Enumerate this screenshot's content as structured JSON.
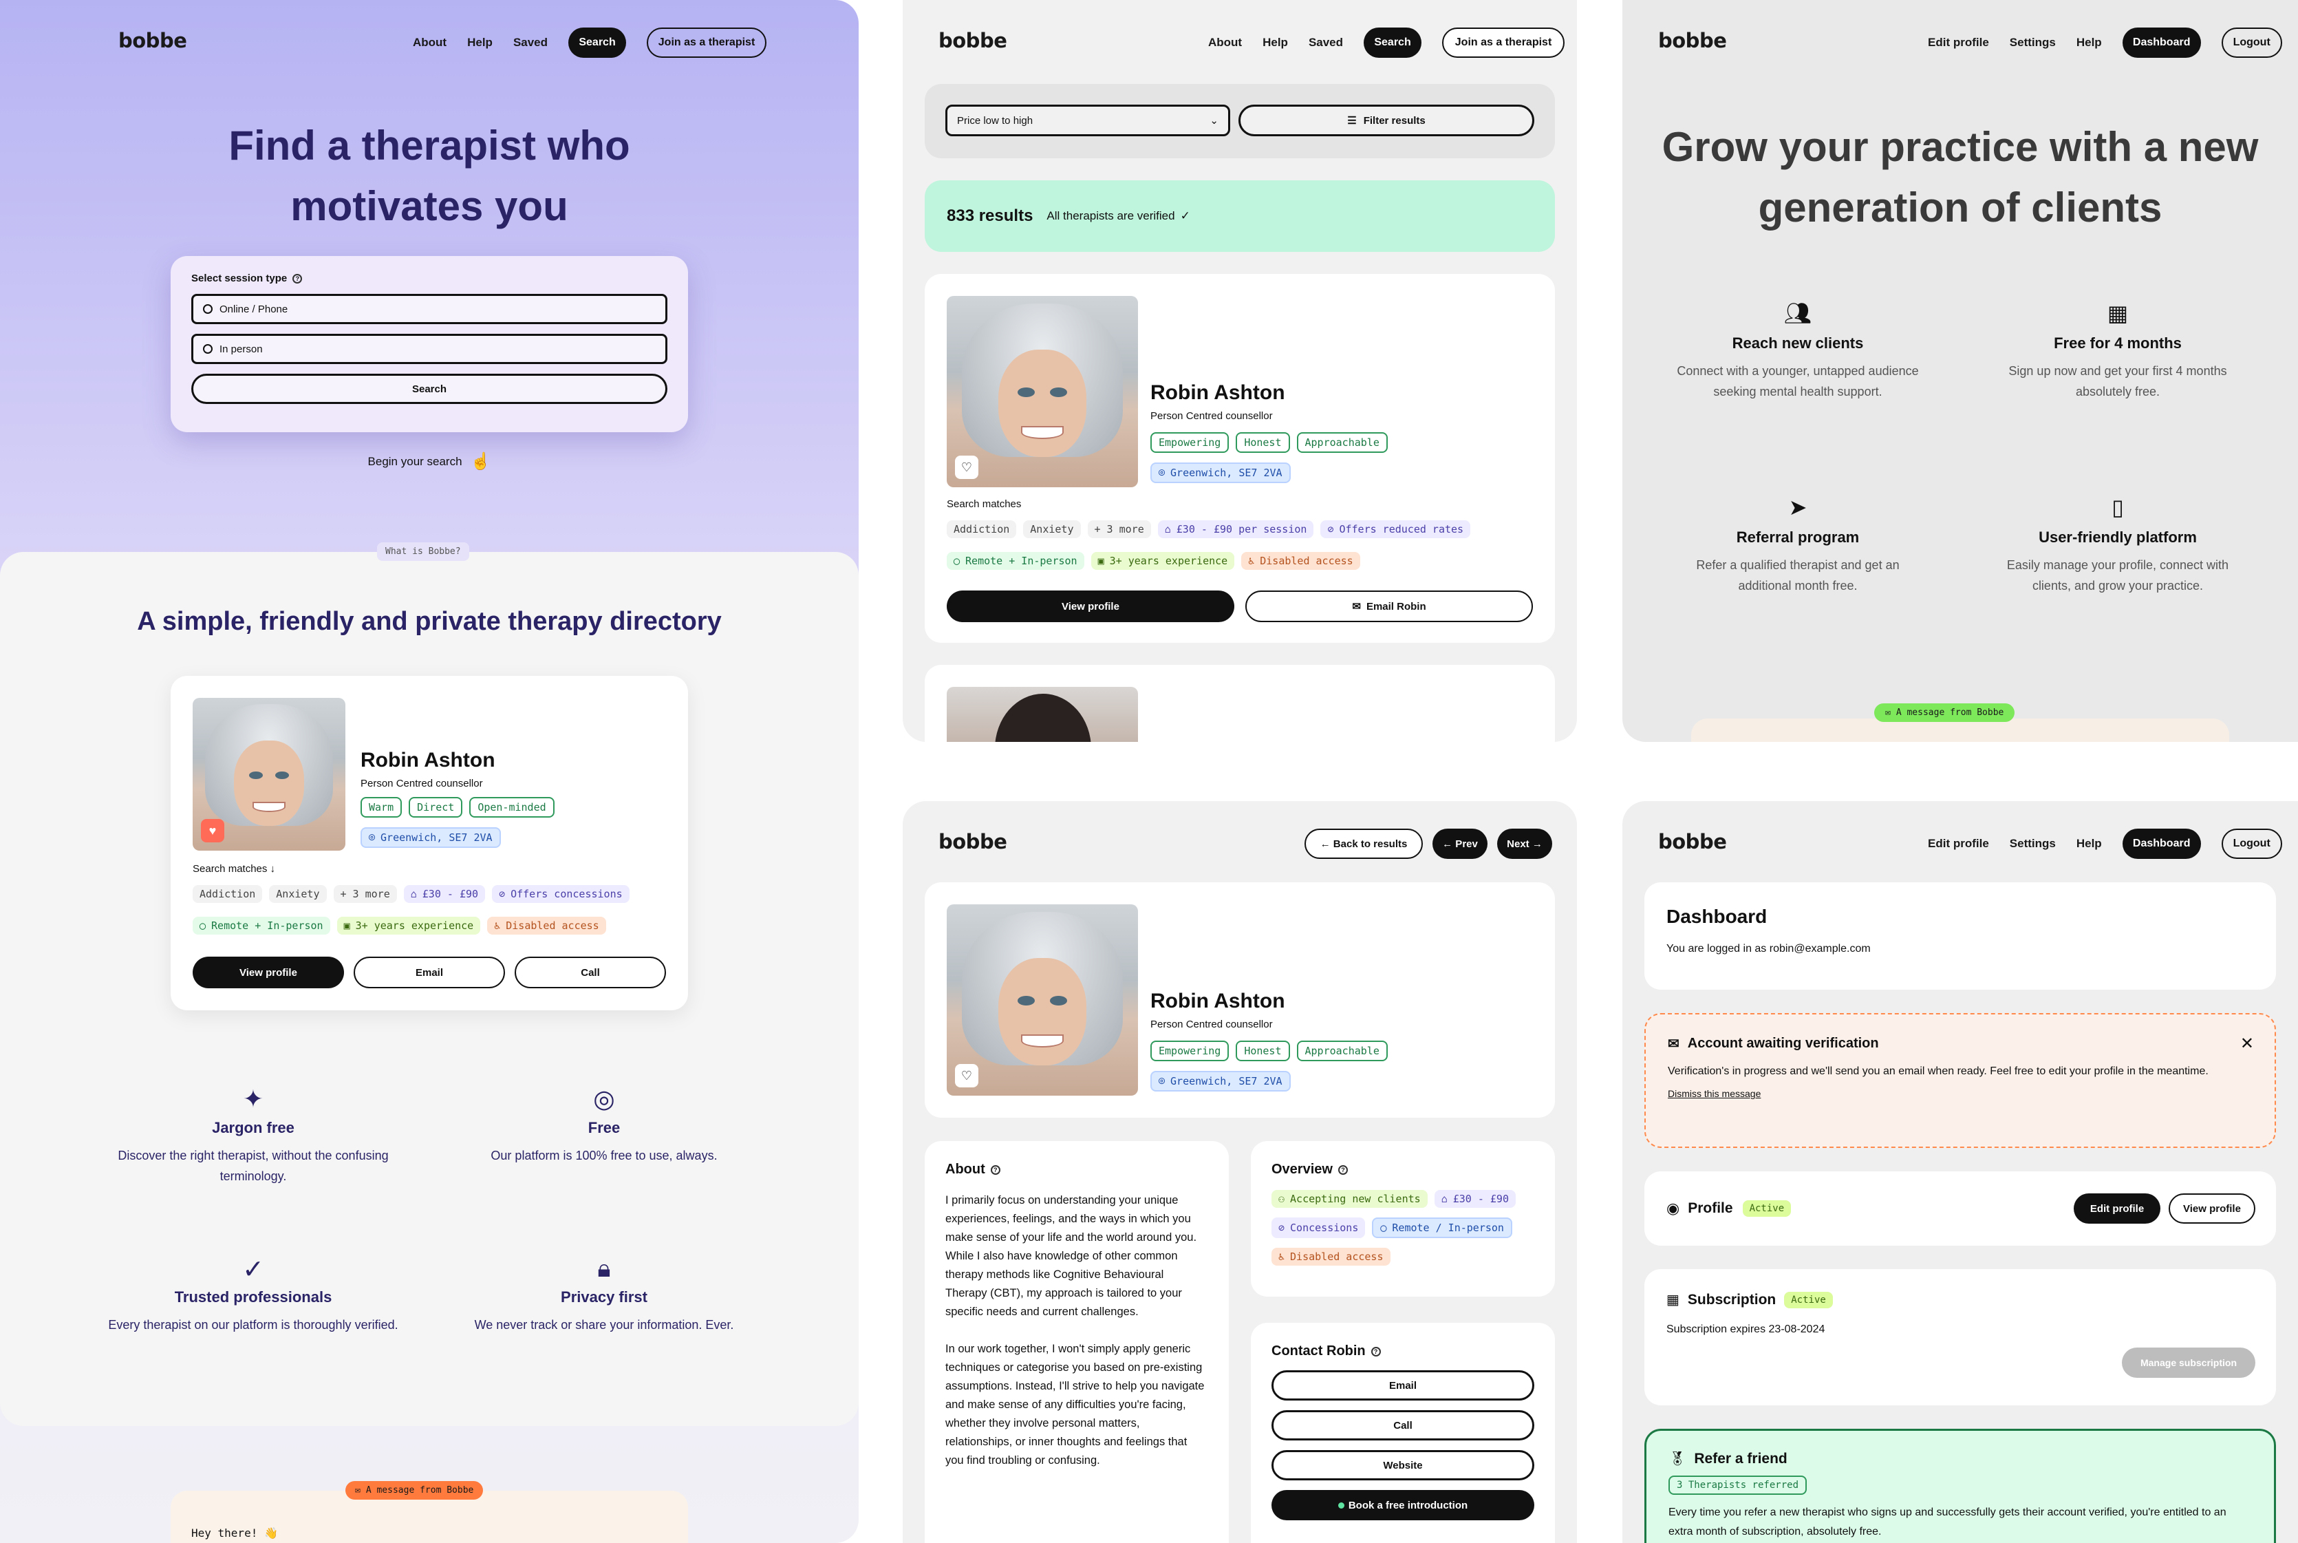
{
  "p1": {
    "logo": "bobbe",
    "nav": [
      "About",
      "Help",
      "Saved"
    ],
    "search_btn": "Search",
    "join_btn": "Join as a therapist",
    "hero_line1": "Find a therapist who",
    "hero_line2": "motivates you",
    "session_label": "Select session type",
    "opt1": "Online / Phone",
    "opt2": "In person",
    "search_button": "Search",
    "begin": "Begin your search",
    "what_tag": "What is Bobbe?",
    "subtitle": "A simple, friendly and private therapy directory",
    "card": {
      "name": "Robin Ashton",
      "role": "Person Centred counsellor",
      "tags": [
        "Warm",
        "Direct",
        "Open-minded"
      ],
      "location": "Greenwich, SE7 2VA",
      "matches": "Search matches ↓",
      "m1": "Addiction",
      "m2": "Anxiety",
      "m3": "+ 3 more",
      "m4": "£30 - £90",
      "m5": "Offers concessions",
      "m6": "Remote + In-person",
      "m7": "3+ years experience",
      "m8": "Disabled access",
      "view": "View profile",
      "email": "Email",
      "call": "Call"
    },
    "features": [
      {
        "title": "Jargon free",
        "text": "Discover the right therapist, without the confusing terminology.",
        "icon": "party-popper-icon"
      },
      {
        "title": "Free",
        "text": "Our platform is 100% free to use, always.",
        "icon": "coins-icon"
      },
      {
        "title": "Trusted professionals",
        "text": "Every therapist on our platform is thoroughly verified.",
        "icon": "check-circle-icon"
      },
      {
        "title": "Privacy first",
        "text": "We never track or share your information. Ever.",
        "icon": "lock-icon"
      }
    ],
    "msg_tag": "A message from Bobbe",
    "msg_text": "Hey there! 👋"
  },
  "p2": {
    "logo": "bobbe",
    "nav": [
      "About",
      "Help",
      "Saved"
    ],
    "search_btn": "Search",
    "join_btn": "Join as a therapist",
    "sort": "Price low to high",
    "filter": "Filter results",
    "count": "833 results",
    "verified": "All therapists are verified",
    "card": {
      "name": "Robin Ashton",
      "role": "Person Centred counsellor",
      "tags": [
        "Empowering",
        "Honest",
        "Approachable"
      ],
      "location": "Greenwich, SE7 2VA",
      "matches": "Search matches",
      "m1": "Addiction",
      "m2": "Anxiety",
      "m3": "+ 3 more",
      "m4": "£30 - £90 per session",
      "m5": "Offers reduced rates",
      "m6": "Remote + In-person",
      "m7": "3+ years experience",
      "m8": "Disabled access",
      "view": "View profile",
      "email": "Email Robin"
    }
  },
  "p3": {
    "logo": "bobbe",
    "nav": [
      "Edit profile",
      "Settings",
      "Help"
    ],
    "dash": "Dashboard",
    "logout": "Logout",
    "hero_line1": "Grow your practice with a new",
    "hero_line2": "generation of clients",
    "features": [
      {
        "title": "Reach new clients",
        "text": "Connect with a younger, untapped audience seeking mental health support.",
        "icon": "users-icon"
      },
      {
        "title": "Free for 4 months",
        "text": "Sign up now and get your first 4 months absolutely free.",
        "icon": "calendar-icon"
      },
      {
        "title": "Referral program",
        "text": "Refer a qualified therapist and get an additional month free.",
        "icon": "send-icon"
      },
      {
        "title": "User-friendly platform",
        "text": "Easily manage your profile, connect with clients, and grow your practice.",
        "icon": "tablet-icon"
      }
    ],
    "msg_tag": "A message from Bobbe"
  },
  "p4": {
    "logo": "bobbe",
    "back": "← Back to results",
    "prev": "← Prev",
    "next": "Next →",
    "card": {
      "name": "Robin Ashton",
      "role": "Person Centred counsellor",
      "tags": [
        "Empowering",
        "Honest",
        "Approachable"
      ],
      "location": "Greenwich, SE7 2VA"
    },
    "about_title": "About",
    "about_p1": "I primarily focus on understanding your unique experiences, feelings, and the ways in which you make sense of your life and the world around you. While I also have knowledge of other common therapy methods like Cognitive Behavioural Therapy (CBT), my approach is tailored to your specific needs and current challenges.",
    "about_p2": "In our work together, I won't simply apply generic techniques or categorise you based on pre-existing assumptions. Instead, I'll strive to help you navigate and make sense of any difficulties you're facing, whether they involve personal matters, relationships, or inner thoughts and feelings that you find troubling or confusing.",
    "overview_title": "Overview",
    "ov1": "Accepting new clients",
    "ov2": "£30 - £90",
    "ov3": "Concessions",
    "ov4": "Remote / In-person",
    "ov5": "Disabled access",
    "contact_title": "Contact Robin",
    "c_email": "Email",
    "c_call": "Call",
    "c_web": "Website",
    "c_book": "Book a free introduction"
  },
  "p5": {
    "logo": "bobbe",
    "nav": [
      "Edit profile",
      "Settings",
      "Help"
    ],
    "dash": "Dashboard",
    "logout": "Logout",
    "dash_title": "Dashboard",
    "logged": "You are logged in as robin@example.com",
    "alert_title": "Account awaiting verification",
    "alert_text": "Verification's in progress and we'll send you an email when ready. Feel free to edit your profile in the meantime.",
    "dismiss": "Dismiss this message",
    "profile": "Profile",
    "active": "Active",
    "edit": "Edit profile",
    "view": "View profile",
    "sub": "Subscription",
    "sub_expires": "Subscription expires 23-08-2024",
    "manage": "Manage subscription",
    "refer": "Refer a friend",
    "referred": "3 Therapists referred",
    "refer_text": "Every time you refer a new therapist who signs up and successfully gets their account verified, you're entitled to an extra month of subscription, absolutely free."
  }
}
